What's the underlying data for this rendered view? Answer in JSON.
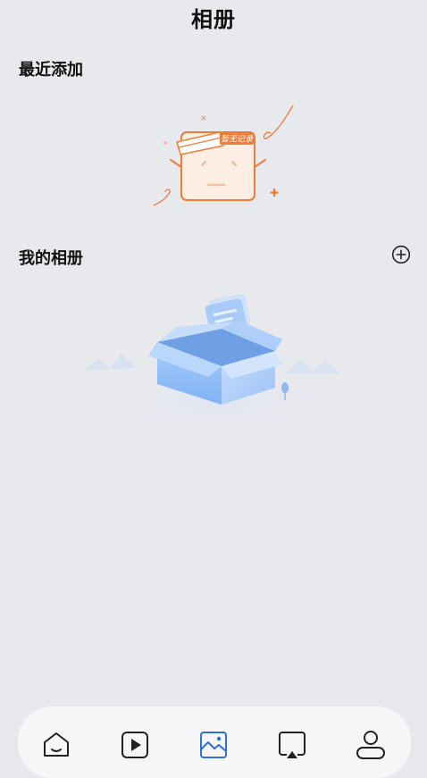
{
  "header": {
    "title": "相册"
  },
  "recent": {
    "section_title": "最近添加",
    "empty_badge_text": "暂无记录"
  },
  "albums": {
    "section_title": "我的相册",
    "add_icon": "plus-circle-icon"
  },
  "tabbar": {
    "active_index": 2,
    "tabs": [
      {
        "icon": "home-icon"
      },
      {
        "icon": "video-play-icon"
      },
      {
        "icon": "photo-album-icon"
      },
      {
        "icon": "screen-cast-icon"
      },
      {
        "icon": "profile-icon"
      }
    ]
  },
  "colors": {
    "background": "#e8e9ed",
    "accent": "#2f6fe0",
    "empty_orange": "#f07c3a",
    "box_blue": "#8bb7f5"
  }
}
